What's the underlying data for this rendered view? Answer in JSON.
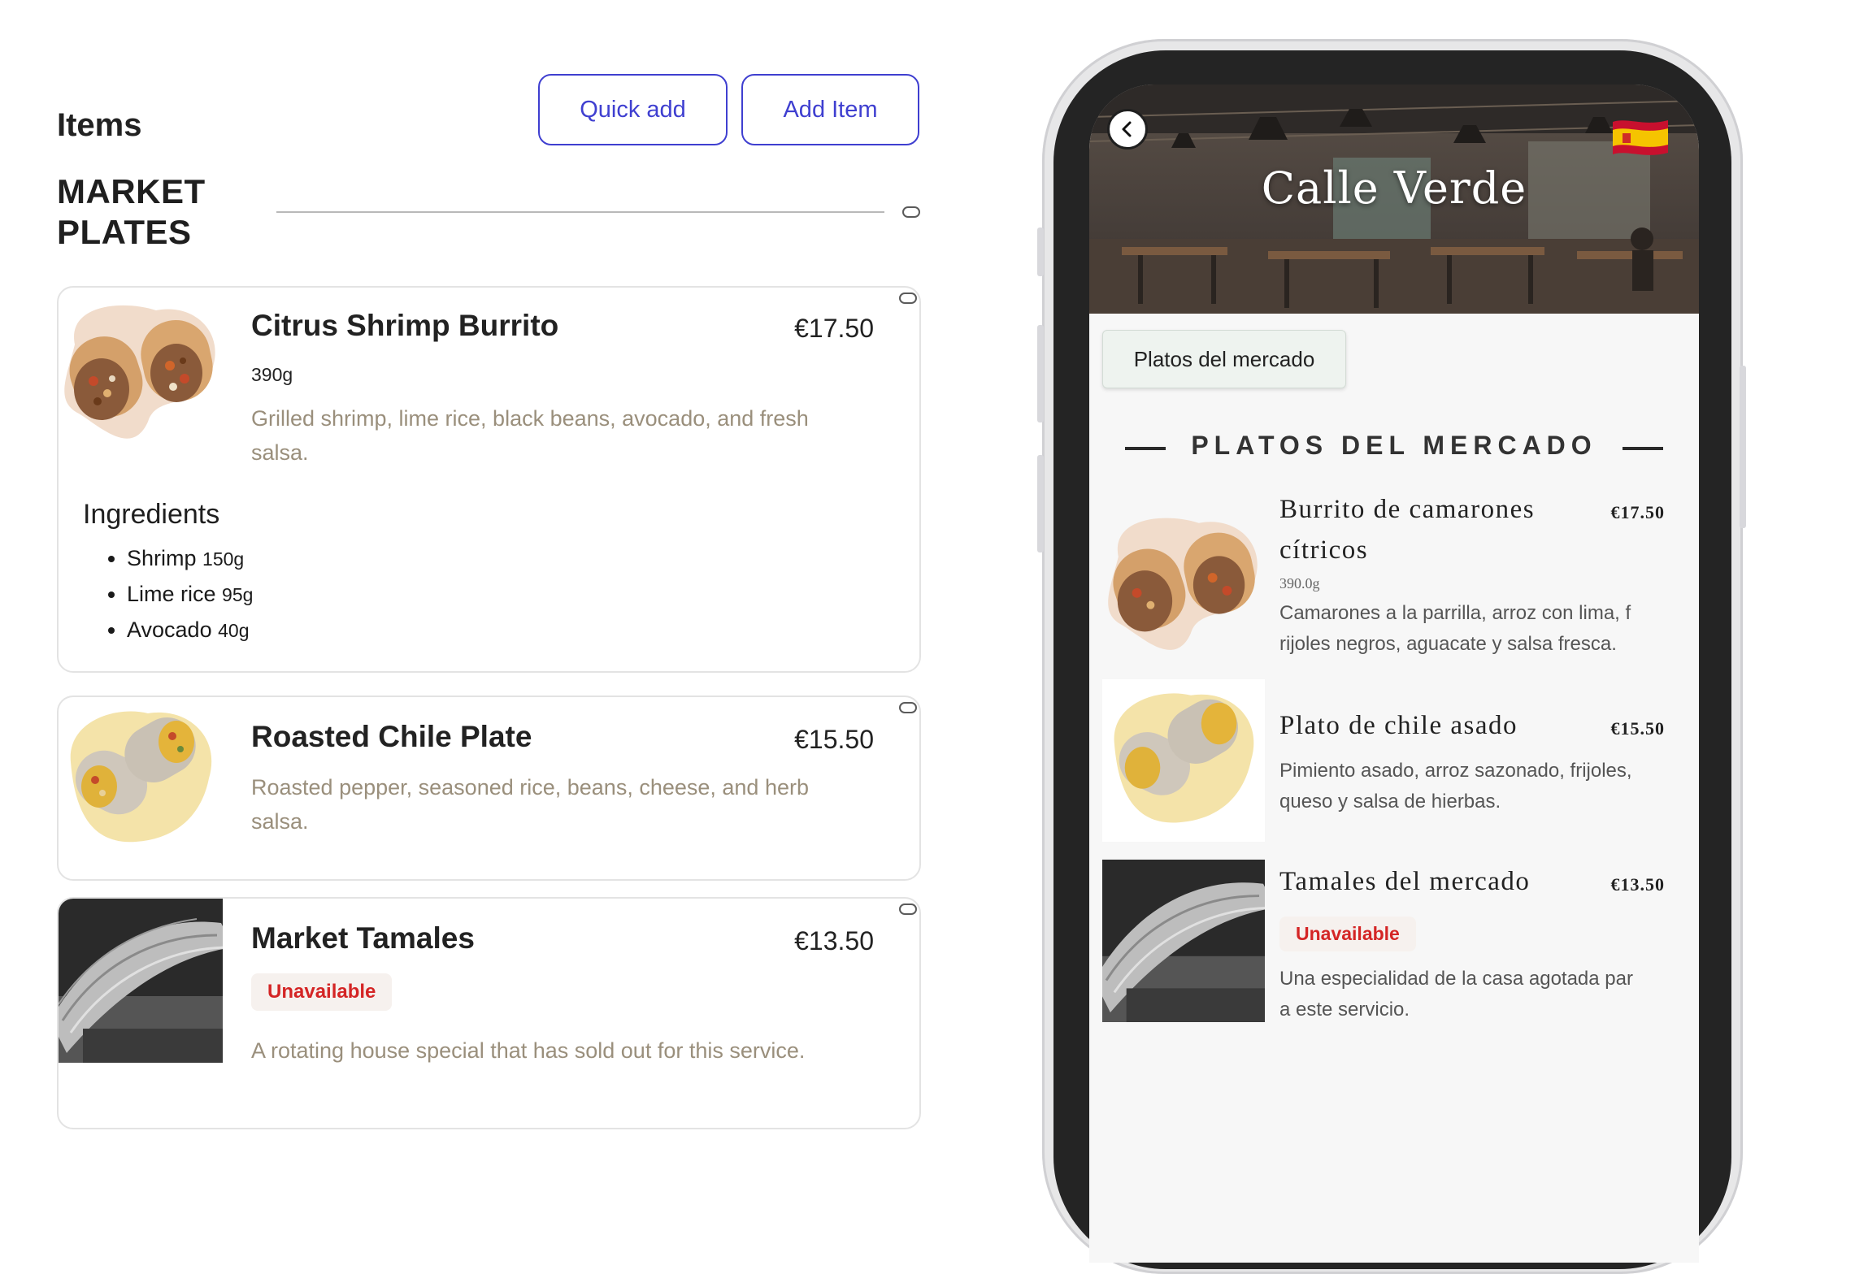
{
  "editor": {
    "title": "Items",
    "quick_add_label": "Quick add",
    "add_item_label": "Add Item",
    "section_title": "MARKET PLATES",
    "items": [
      {
        "name": "Citrus Shrimp Burrito",
        "price": "€17.50",
        "weight": "390g",
        "description": "Grilled shrimp, lime rice, black beans, avocado, and fresh salsa.",
        "ingredients_title": "Ingredients",
        "ingredients": [
          {
            "name": "Shrimp",
            "qty": "150g"
          },
          {
            "name": "Lime rice",
            "qty": "95g"
          },
          {
            "name": "Avocado",
            "qty": "40g"
          }
        ]
      },
      {
        "name": "Roasted Chile Plate",
        "price": "€15.50",
        "description": "Roasted pepper, seasoned rice, beans, cheese, and herb salsa."
      },
      {
        "name": "Market Tamales",
        "price": "€13.50",
        "status": "Unavailable",
        "description": "A rotating house special that has sold out for this service."
      }
    ]
  },
  "preview": {
    "restaurant_name": "Calle Verde",
    "flag": "spain-flag",
    "category_chip": "Platos del mercado",
    "section_title": "PLATOS DEL MERCADO",
    "items": [
      {
        "name": "Burrito de camarones cítricos",
        "price": "€17.50",
        "weight": "390.0g",
        "description": "Camarones a la parrilla, arroz con lima, f\nrijoles negros, aguacate y salsa fresca."
      },
      {
        "name": "Plato de chile asado",
        "price": "€15.50",
        "description": "Pimiento asado, arroz sazonado, frijoles,\nqueso y salsa de hierbas."
      },
      {
        "name": "Tamales del mercado",
        "price": "€13.50",
        "status": "Unavailable",
        "description": "Una especialidad de la casa agotada par\na este servicio."
      }
    ]
  },
  "colors": {
    "accent": "#3f3fd0",
    "description_text": "#9a8f7c",
    "unavailable_red": "#d42525",
    "phone_bezel": "#242424"
  }
}
